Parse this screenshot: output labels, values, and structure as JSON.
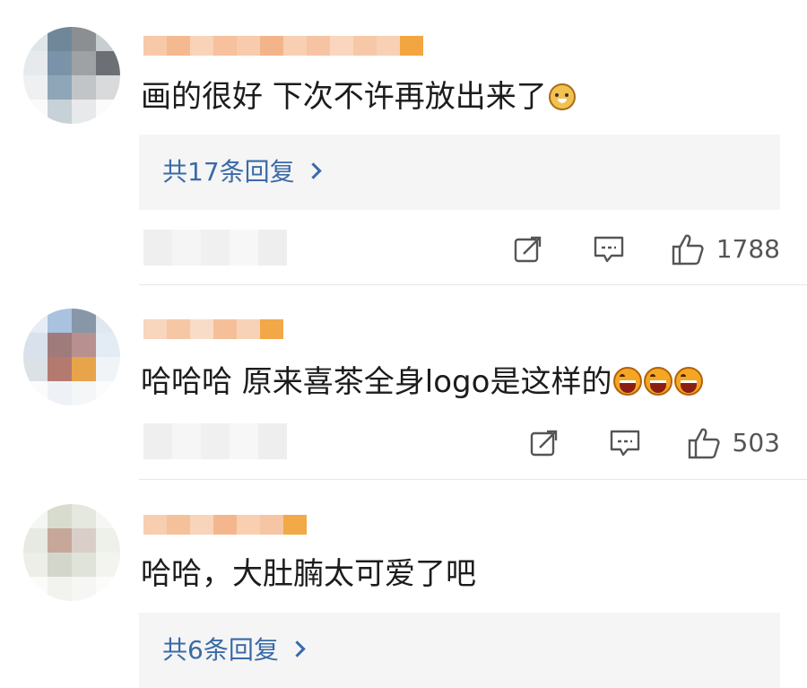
{
  "comments": [
    {
      "text": "画的很好 下次不许再放出来了",
      "emoji": "doge-icon",
      "replies_label": "共17条回复",
      "like_count": "1788"
    },
    {
      "text": "哈哈哈 原来喜茶全身logo是这样的",
      "emoji": "laugh-icon",
      "emoji_count": 3,
      "like_count": "503"
    },
    {
      "text": "哈哈，大肚腩太可爱了吧",
      "replies_label": "共6条回复"
    }
  ],
  "icons": {
    "share": "share-icon",
    "comment": "comment-icon",
    "like": "thumbs-up-icon",
    "chevron": "chevron-right-icon"
  },
  "colors": {
    "reply_link": "#3a6aa8",
    "reply_box": "#f5f5f5",
    "muted": "#555555"
  }
}
